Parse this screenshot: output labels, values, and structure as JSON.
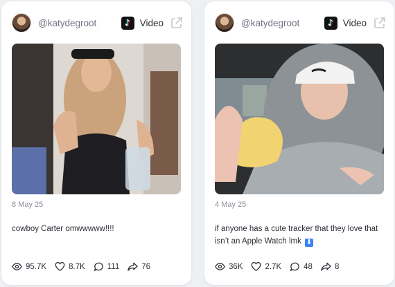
{
  "colors": {
    "card_bg": "#ffffff",
    "page_bg": "#eef0f3",
    "muted_text": "#8a909b",
    "handle_text": "#6c7380"
  },
  "icons": {
    "platform": "tiktok-icon",
    "external": "external-link-icon",
    "views": "eye-icon",
    "likes": "heart-icon",
    "comments": "comment-icon",
    "shares": "share-icon"
  },
  "cards": [
    {
      "handle": "@katydegroot",
      "platform_label": "Video",
      "date": "8 May 25",
      "caption": "cowboy Carter omwwwww!!!!",
      "caption_emoji": "",
      "stats": {
        "views": "95.7K",
        "likes": "8.7K",
        "comments": "111",
        "shares": "76"
      }
    },
    {
      "handle": "@katydegroot",
      "platform_label": "Video",
      "date": "4 May 25",
      "caption": "if anyone has a cute tracker that they love that isn’t an Apple Watch lmk",
      "caption_emoji": "⬇",
      "stats": {
        "views": "36K",
        "likes": "2.7K",
        "comments": "48",
        "shares": "8"
      }
    }
  ]
}
